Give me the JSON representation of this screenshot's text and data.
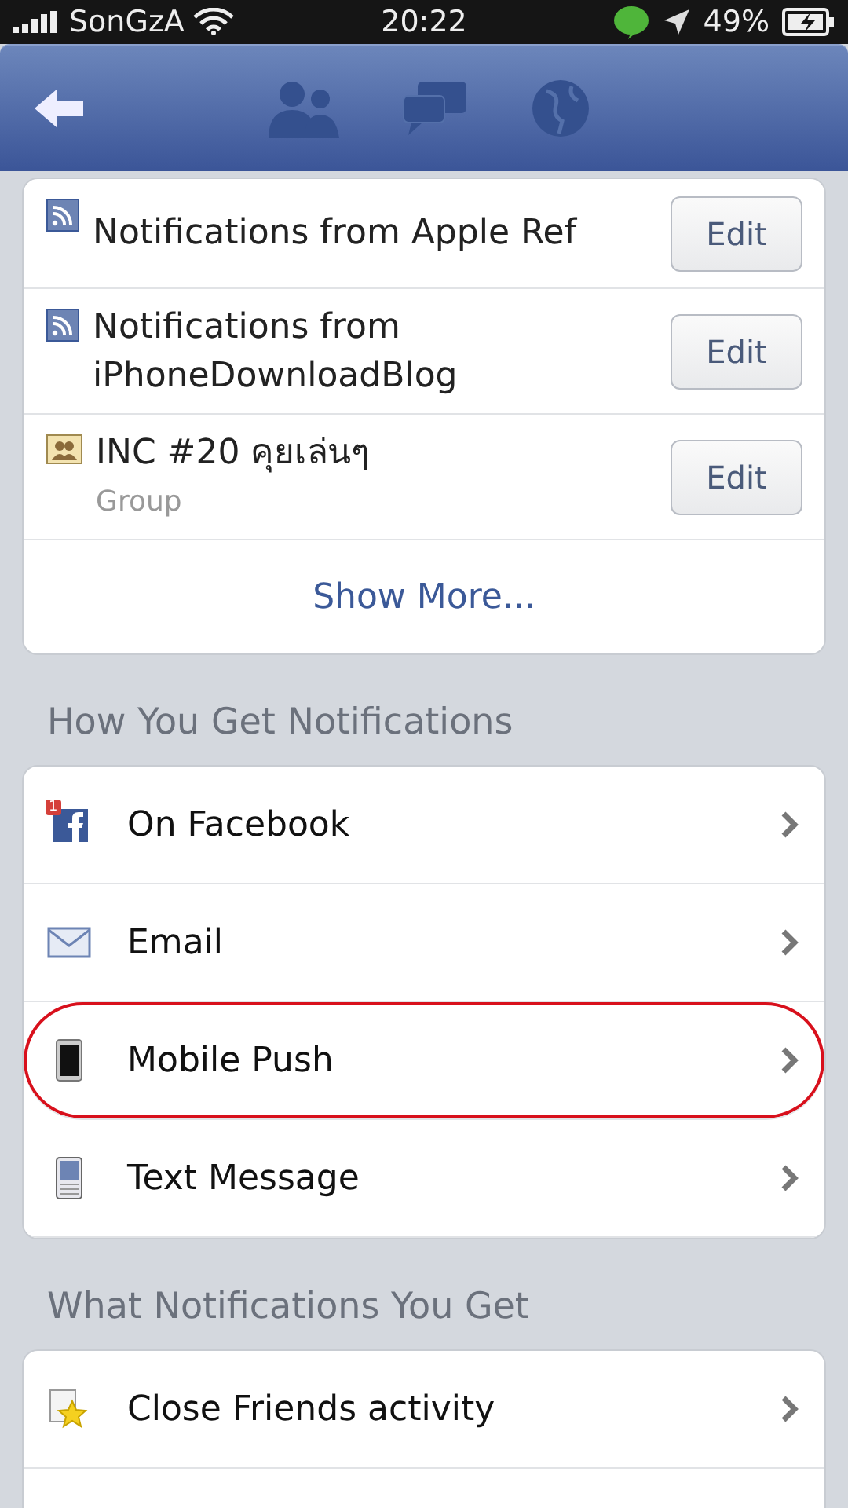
{
  "status_bar": {
    "carrier": "SonGzA",
    "time": "20:22",
    "battery": "49%"
  },
  "subscriptions": [
    {
      "kind": "rss",
      "title": "Notifications from Apple Ref",
      "button": "Edit"
    },
    {
      "kind": "rss",
      "title": "Notifications from iPhoneDownloadBlog",
      "button": "Edit"
    },
    {
      "kind": "group",
      "title": "INC #20 คุยเล่นๆ",
      "subtitle": "Group",
      "button": "Edit"
    }
  ],
  "show_more": "Show More...",
  "sections": [
    {
      "title": "How You Get Notifications",
      "items": [
        {
          "kind": "facebook",
          "badge": "1",
          "label": "On Facebook",
          "highlighted": false
        },
        {
          "kind": "email",
          "label": "Email",
          "highlighted": false
        },
        {
          "kind": "phone",
          "label": "Mobile Push",
          "highlighted": true
        },
        {
          "kind": "sms",
          "label": "Text Message",
          "highlighted": false
        }
      ]
    },
    {
      "title": "What Notifications You Get",
      "items": [
        {
          "kind": "star",
          "label": "Close Friends activity",
          "highlighted": false
        }
      ]
    }
  ]
}
